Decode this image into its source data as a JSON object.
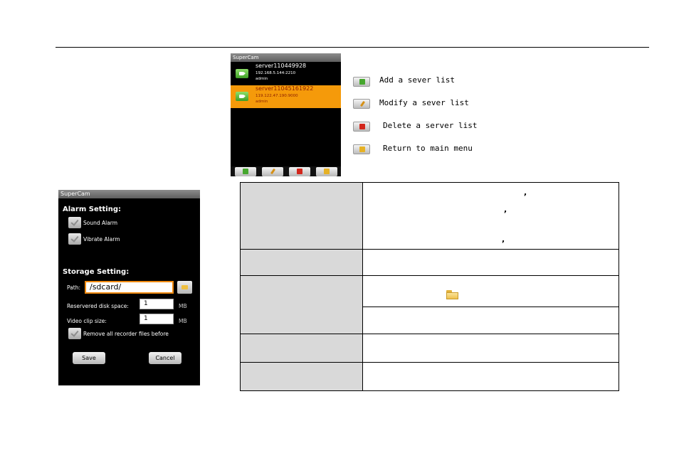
{
  "server_list_screen": {
    "title": "SuperCam",
    "servers": [
      {
        "name": "server110449928",
        "address": "192.168.5.144:2210",
        "user": "admin",
        "selected": false
      },
      {
        "name": "server11045161922",
        "address": "119.122.47.190:9000",
        "user": "admin",
        "selected": true
      }
    ],
    "toolbar_icons": [
      "add-server-icon",
      "modify-server-icon",
      "delete-server-icon",
      "return-menu-icon"
    ]
  },
  "legend": {
    "add": "Add a sever list",
    "modify": "Modify a sever list",
    "delete": "Delete a server list",
    "return": "Return to main menu"
  },
  "settings_screen": {
    "title": "SuperCam",
    "alarm_heading": "Alarm Setting:",
    "sound_alarm": "Sound Alarm",
    "vibrate_alarm": "Vibrate Alarm",
    "storage_heading": "Storage Setting:",
    "path_label": "Path:",
    "path_value": "/sdcard/",
    "disk_space_label": "Reservered disk space:",
    "disk_space_value": "1",
    "disk_space_unit": "MB",
    "clip_size_label": "Video clip size:",
    "clip_size_value": "1",
    "clip_size_unit": "MB",
    "remove_files": "Remove all recorder files before",
    "save": "Save",
    "cancel": "Cancel"
  },
  "table": {
    "comma": ","
  },
  "colors": {
    "selected_row": "#f59a0a",
    "path_border": "#f08a10",
    "table_key_bg": "#d9d9d9"
  }
}
